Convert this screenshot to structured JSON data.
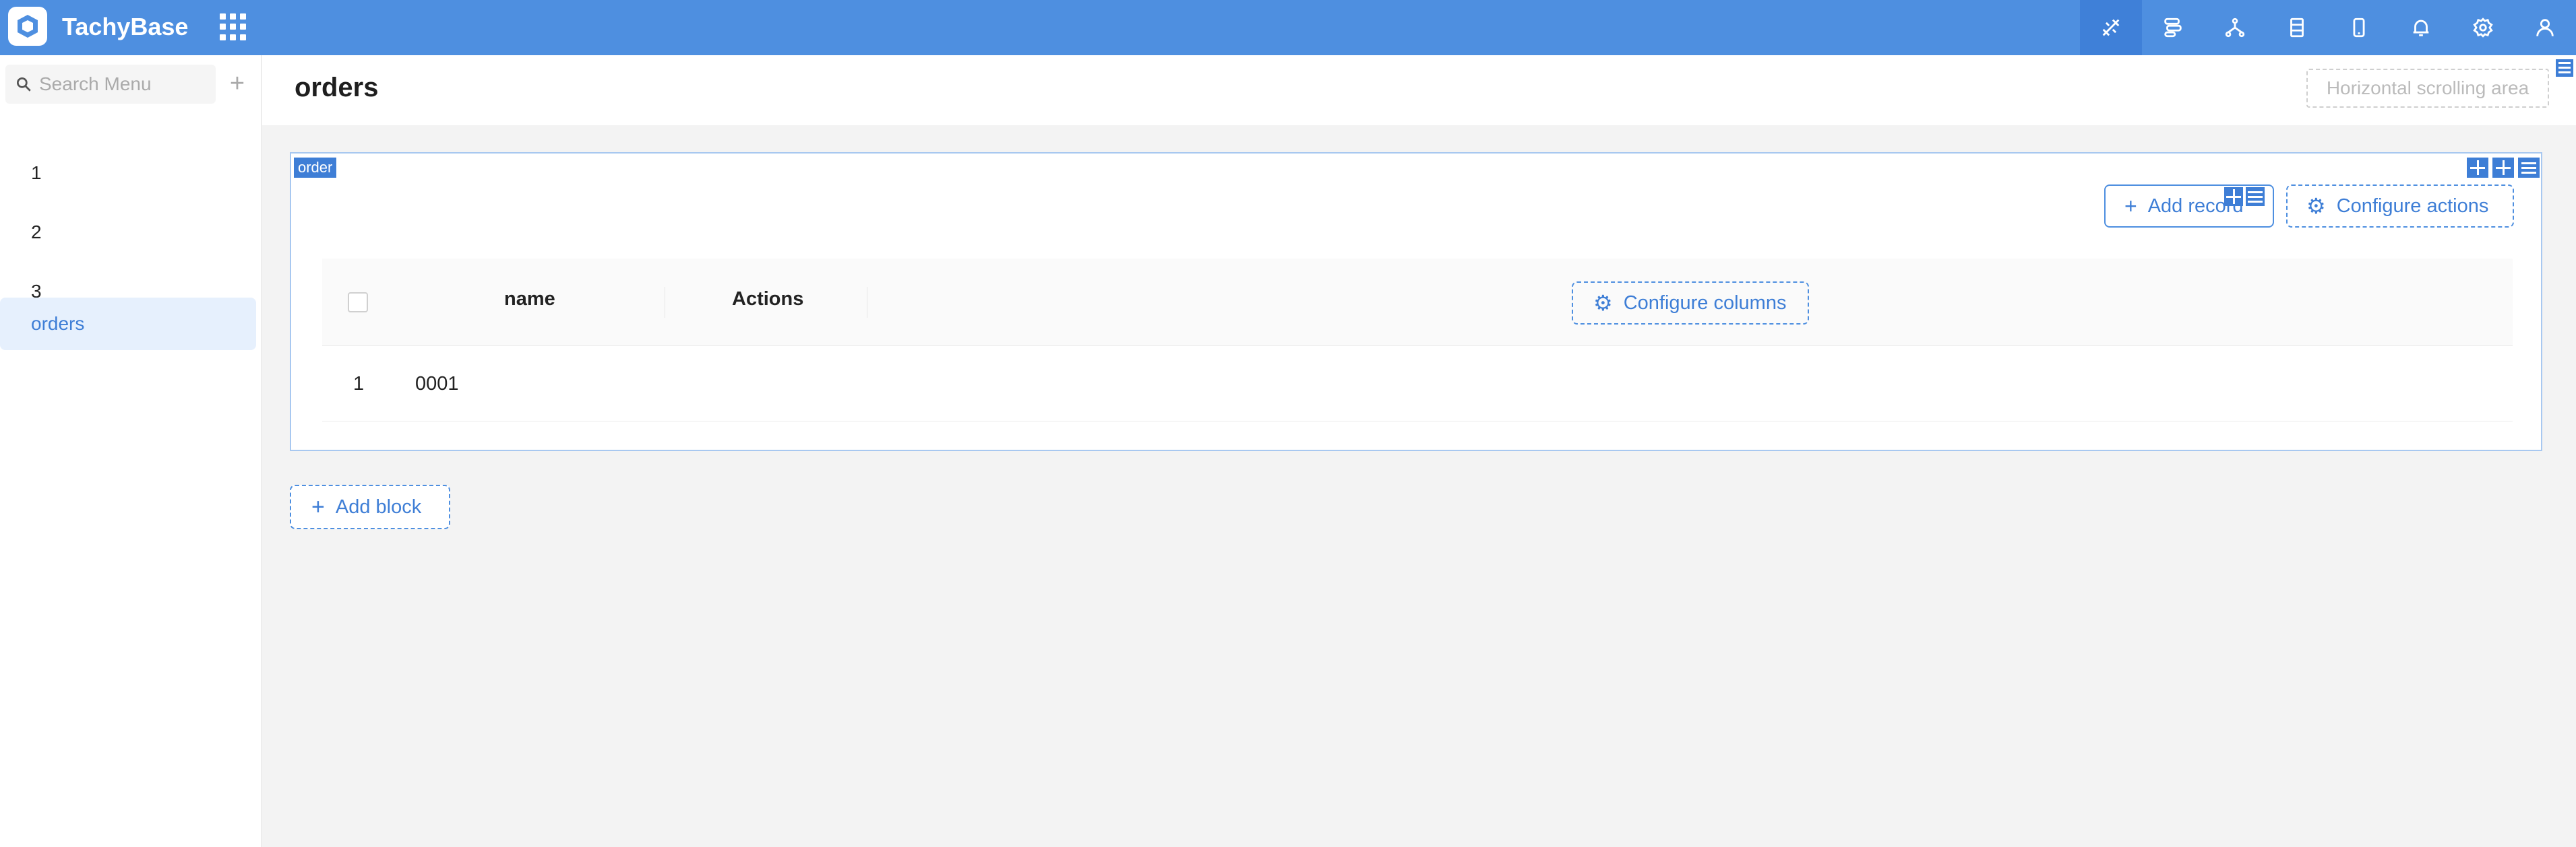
{
  "app": {
    "brand": "TachyBase"
  },
  "topbar": {
    "icons": [
      "ui-editor-icon",
      "workflow-icon",
      "graph-icon",
      "document-icon",
      "mobile-icon",
      "bell-icon",
      "gear-icon",
      "user-icon"
    ]
  },
  "sidebar": {
    "search_placeholder": "Search Menu",
    "add_label": "+",
    "items": [
      {
        "label": "1"
      },
      {
        "label": "2"
      },
      {
        "label": "3"
      },
      {
        "label": "orders"
      }
    ]
  },
  "page": {
    "title": "orders",
    "horizontal_scroll_label": "Horizontal scrolling area"
  },
  "block": {
    "tag": "order",
    "add_record_label": "Add record",
    "configure_actions_label": "Configure actions",
    "columns": [
      "name",
      "Actions"
    ],
    "configure_columns_label": "Configure columns",
    "rows": [
      {
        "index": "1",
        "name": "0001"
      }
    ]
  },
  "add_block_label": "Add block",
  "colors": {
    "accent": "#4e8fe0",
    "active_bg": "#e6f0fd",
    "active_text": "#3e7ed6"
  }
}
